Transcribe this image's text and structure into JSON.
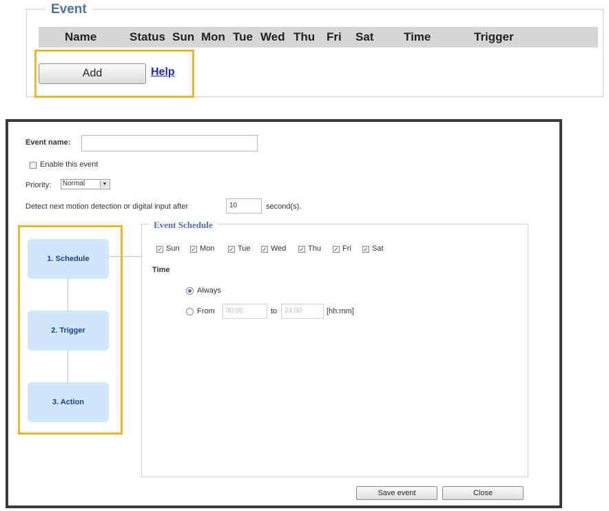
{
  "event_list": {
    "legend": "Event",
    "columns": [
      "Name",
      "Status",
      "Sun",
      "Mon",
      "Tue",
      "Wed",
      "Thu",
      "Fri",
      "Sat",
      "Time",
      "Trigger"
    ],
    "add_label": "Add",
    "help_label": "Help"
  },
  "dialog": {
    "event_name_label": "Event name:",
    "event_name_value": "",
    "enable_label": "Enable this event",
    "priority_label": "Priority:",
    "priority_value": "Normal",
    "detect_label": "Detect next motion detection or digital input after",
    "detect_value": "10",
    "detect_unit": "second(s).",
    "steps": [
      "1. Schedule",
      "2. Trigger",
      "3. Action"
    ],
    "schedule": {
      "legend": "Event Schedule",
      "days": [
        "Sun",
        "Mon",
        "Tue",
        "Wed",
        "Thu",
        "Fri",
        "Sat"
      ],
      "time_label": "Time",
      "always_label": "Always",
      "from_label": "From",
      "from_value": "00:00",
      "to_label": "to",
      "to_value": "24:00",
      "format_label": "[hh:mm]"
    },
    "save_label": "Save event",
    "close_label": "Close"
  },
  "colors": {
    "highlight": "#e8b82a",
    "legend_blue": "#4d6fa5",
    "step_fill": "#cfe6fb"
  }
}
